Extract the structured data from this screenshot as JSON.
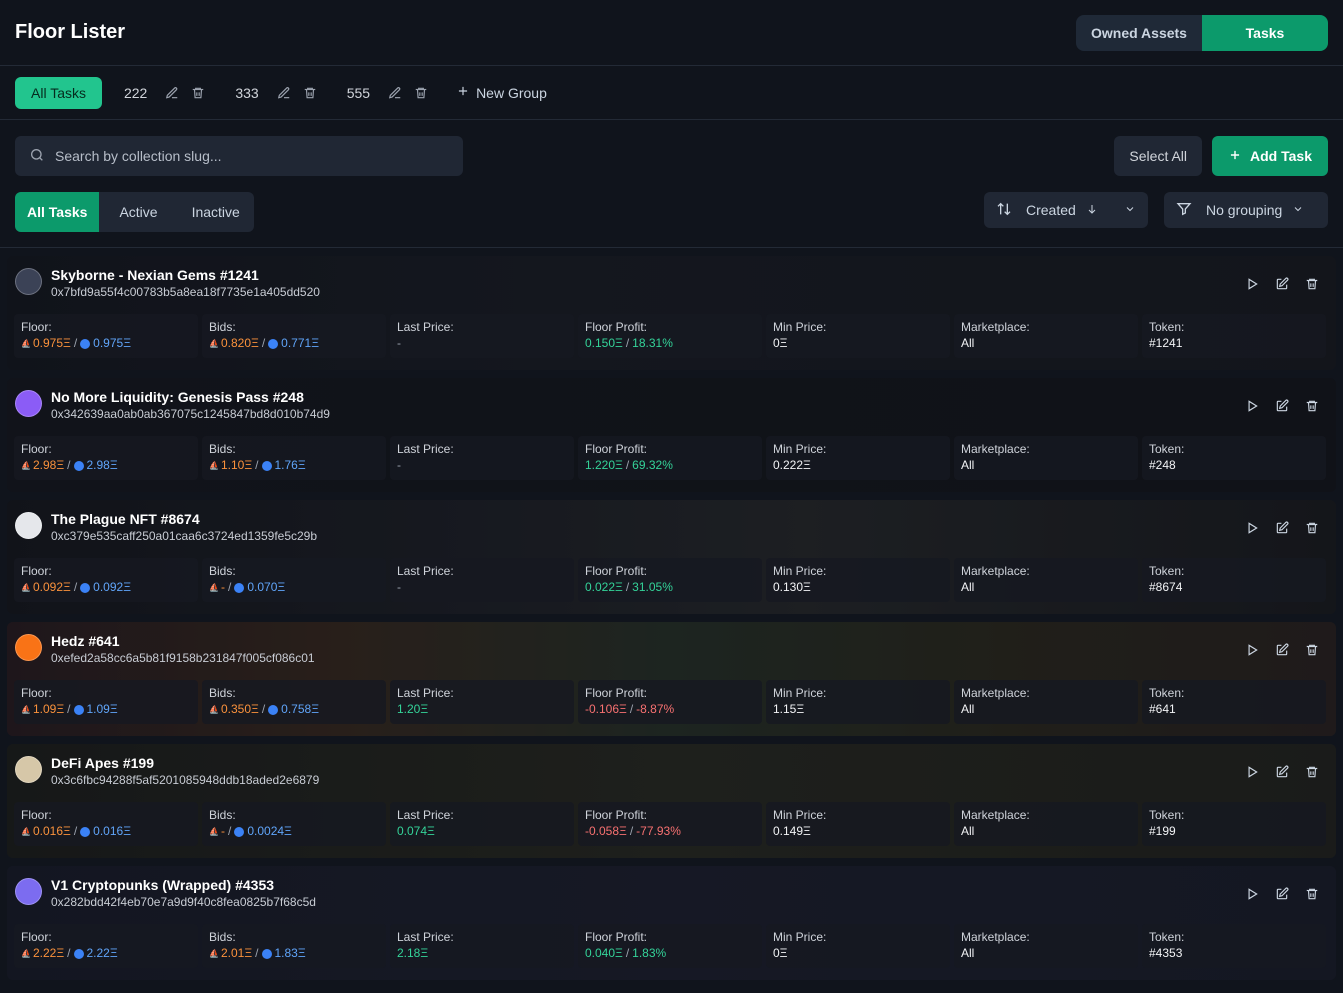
{
  "app": {
    "title": "Floor Lister"
  },
  "view_switch": {
    "owned": "Owned Assets",
    "tasks": "Tasks"
  },
  "groups": {
    "all": "All Tasks",
    "items": [
      {
        "name": "222"
      },
      {
        "name": "333"
      },
      {
        "name": "555"
      }
    ],
    "new_group": "New Group"
  },
  "search": {
    "placeholder": "Search by collection slug..."
  },
  "toolbar": {
    "select_all": "Select All",
    "add_task": "Add Task"
  },
  "filters": {
    "all": "All Tasks",
    "active": "Active",
    "inactive": "Inactive"
  },
  "sort": {
    "label": "Created",
    "grouping": "No grouping"
  },
  "labels": {
    "floor": "Floor:",
    "bids": "Bids:",
    "last_price": "Last Price:",
    "floor_profit": "Floor Profit:",
    "min_price": "Min Price:",
    "marketplace": "Marketplace:",
    "token": "Token:"
  },
  "colors": {
    "accent": "#0c9a6b",
    "accent_light": "#22c58e",
    "opensea": "#fb923c",
    "blur": "#60a5fa",
    "profit_pos": "#34d399",
    "profit_neg": "#f87171"
  },
  "tasks": [
    {
      "title": "Skyborne - Nexian Gems #1241",
      "address": "0x7bfd9a55f4c00783b5a8ea18f7735e1a405dd520",
      "floor_os": "0.975Ξ",
      "floor_blur": "0.975Ξ",
      "bid_os": "0.820Ξ",
      "bid_blur": "0.771Ξ",
      "last_price": "-",
      "profit_eth": "0.150Ξ",
      "profit_pct": "18.31%",
      "min_price": "0Ξ",
      "marketplace": "All",
      "token": "#1241",
      "avatar": "#3b4256"
    },
    {
      "title": "No More Liquidity: Genesis Pass #248",
      "address": "0x342639aa0ab0ab367075c1245847bd8d010b74d9",
      "floor_os": "2.98Ξ",
      "floor_blur": "2.98Ξ",
      "bid_os": "1.10Ξ",
      "bid_blur": "1.76Ξ",
      "last_price": "-",
      "profit_eth": "1.220Ξ",
      "profit_pct": "69.32%",
      "min_price": "0.222Ξ",
      "marketplace": "All",
      "token": "#248",
      "avatar": "#8b5cf6"
    },
    {
      "title": "The Plague NFT #8674",
      "address": "0xc379e535caff250a01caa6c3724ed1359fe5c29b",
      "floor_os": "0.092Ξ",
      "floor_blur": "0.092Ξ",
      "bid_os": "-",
      "bid_blur": "0.070Ξ",
      "last_price": "-",
      "profit_eth": "0.022Ξ",
      "profit_pct": "31.05%",
      "min_price": "0.130Ξ",
      "marketplace": "All",
      "token": "#8674",
      "avatar": "#e5e7eb"
    },
    {
      "title": "Hedz #641",
      "address": "0xefed2a58cc6a5b81f9158b231847f005cf086c01",
      "floor_os": "1.09Ξ",
      "floor_blur": "1.09Ξ",
      "bid_os": "0.350Ξ",
      "bid_blur": "0.758Ξ",
      "last_price": "1.20Ξ",
      "profit_eth": "-0.106Ξ",
      "profit_pct": "-8.87%",
      "min_price": "1.15Ξ",
      "marketplace": "All",
      "token": "#641",
      "avatar": "#f97316"
    },
    {
      "title": "DeFi Apes #199",
      "address": "0x3c6fbc94288f5af5201085948ddb18aded2e6879",
      "floor_os": "0.016Ξ",
      "floor_blur": "0.016Ξ",
      "bid_os": "-",
      "bid_blur": "0.0024Ξ",
      "last_price": "0.074Ξ",
      "profit_eth": "-0.058Ξ",
      "profit_pct": "-77.93%",
      "min_price": "0.149Ξ",
      "marketplace": "All",
      "token": "#199",
      "avatar": "#d6c7a8"
    },
    {
      "title": "V1 Cryptopunks (Wrapped) #4353",
      "address": "0x282bdd42f4eb70e7a9d9f40c8fea0825b7f68c5d",
      "floor_os": "2.22Ξ",
      "floor_blur": "2.22Ξ",
      "bid_os": "2.01Ξ",
      "bid_blur": "1.83Ξ",
      "last_price": "2.18Ξ",
      "profit_eth": "0.040Ξ",
      "profit_pct": "1.83%",
      "min_price": "0Ξ",
      "marketplace": "All",
      "token": "#4353",
      "avatar": "#7c6cf0"
    }
  ]
}
